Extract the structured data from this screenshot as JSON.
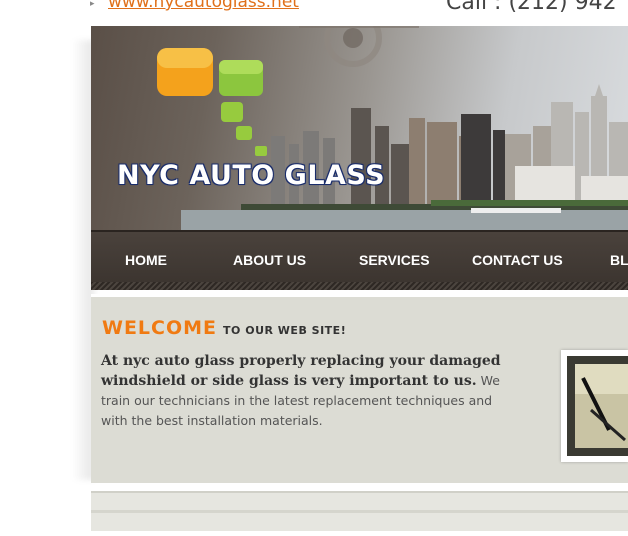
{
  "header": {
    "site_link": "www.nycautoglass.net",
    "phone": "Call : (212) 942"
  },
  "banner": {
    "logo_text": "NYC AUTO GLASS"
  },
  "nav": {
    "items": [
      "HOME",
      "ABOUT US",
      "SERVICES",
      "CONTACT US",
      "BL"
    ]
  },
  "welcome": {
    "title_big": "WELCOME",
    "title_small": "TO OUR WEB SITE!",
    "intro_bold": "At nyc auto glass properly replacing your damaged windshield or side glass is very important to us.",
    "intro_plain": " We train our technicians in the latest replacement techniques and with the best installation materials."
  },
  "colors": {
    "accent_orange": "#f07a12",
    "nav_bg": "#3f3833",
    "panel_bg": "#dcdcd4"
  }
}
